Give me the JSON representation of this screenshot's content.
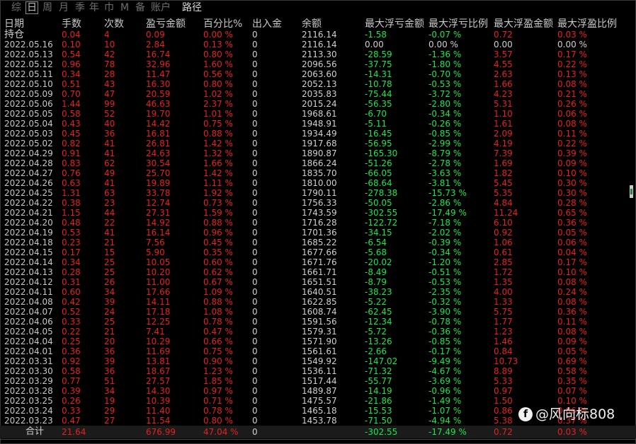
{
  "tabs": [
    {
      "label": "综",
      "active": false
    },
    {
      "label": "日",
      "active": true
    },
    {
      "label": "周",
      "active": false
    },
    {
      "label": "月",
      "active": false
    },
    {
      "label": "季",
      "active": false
    },
    {
      "label": "年",
      "active": false
    },
    {
      "label": "巾",
      "active": false
    },
    {
      "label": "M",
      "active": false
    },
    {
      "label": "备",
      "active": false
    },
    {
      "label": "账户",
      "active": false
    },
    {
      "label": "路径",
      "active": false
    }
  ],
  "headers": [
    "日期",
    "手数",
    "次数",
    "盈亏金额",
    "百分比%",
    "出入金",
    "余额",
    "最大浮亏金额",
    "最大浮亏比例",
    "最大浮盈金额",
    "最大浮盈比例"
  ],
  "holding": {
    "label": "持仓",
    "lots": "0.04",
    "count": "4",
    "pnl": "0.09",
    "pct": "0.00 %",
    "flow": "0",
    "balance": "2116.14",
    "max_loss": "-1.58",
    "max_loss_pct": "-0.07 %",
    "max_gain": "0.72",
    "max_gain_pct": "0.03 %"
  },
  "rows": [
    {
      "date": "2022.05.16",
      "lots": "0.10",
      "count": "10",
      "pnl": "2.84",
      "pct": "0.13 %",
      "flow": "0",
      "balance": "2116.14",
      "max_loss": "0.00",
      "max_loss_pct": "0.00 %",
      "max_gain": "0.00",
      "max_gain_pct": "0.00 %",
      "zero": true
    },
    {
      "date": "2022.05.13",
      "lots": "0.54",
      "count": "42",
      "pnl": "16.74",
      "pct": "0.80 %",
      "flow": "0",
      "balance": "2113.30",
      "max_loss": "-28.59",
      "max_loss_pct": "-1.36 %",
      "max_gain": "3.57",
      "max_gain_pct": "0.17 %"
    },
    {
      "date": "2022.05.12",
      "lots": "0.96",
      "count": "78",
      "pnl": "32.96",
      "pct": "1.60 %",
      "flow": "0",
      "balance": "2096.56",
      "max_loss": "-37.75",
      "max_loss_pct": "-1.80 %",
      "max_gain": "4.55",
      "max_gain_pct": "0.22 %"
    },
    {
      "date": "2022.05.11",
      "lots": "0.34",
      "count": "28",
      "pnl": "11.47",
      "pct": "0.56 %",
      "flow": "0",
      "balance": "2063.60",
      "max_loss": "-14.31",
      "max_loss_pct": "-0.70 %",
      "max_gain": "2.63",
      "max_gain_pct": "0.13 %"
    },
    {
      "date": "2022.05.10",
      "lots": "0.51",
      "count": "43",
      "pnl": "16.30",
      "pct": "0.80 %",
      "flow": "0",
      "balance": "2052.13",
      "max_loss": "-10.78",
      "max_loss_pct": "-0.53 %",
      "max_gain": "1.66",
      "max_gain_pct": "0.08 %"
    },
    {
      "date": "2022.05.09",
      "lots": "0.70",
      "count": "47",
      "pnl": "20.59",
      "pct": "1.02 %",
      "flow": "0",
      "balance": "2035.83",
      "max_loss": "-75.44",
      "max_loss_pct": "-3.72 %",
      "max_gain": "4.23",
      "max_gain_pct": "0.21 %"
    },
    {
      "date": "2022.05.06",
      "lots": "1.44",
      "count": "99",
      "pnl": "46.63",
      "pct": "2.37 %",
      "flow": "0",
      "balance": "2015.24",
      "max_loss": "-56.35",
      "max_loss_pct": "-2.80 %",
      "max_gain": "5.31",
      "max_gain_pct": "0.26 %"
    },
    {
      "date": "2022.05.05",
      "lots": "0.58",
      "count": "52",
      "pnl": "19.70",
      "pct": "1.01 %",
      "flow": "0",
      "balance": "1968.61",
      "max_loss": "-6.70",
      "max_loss_pct": "-0.34 %",
      "max_gain": "1.10",
      "max_gain_pct": "0.06 %"
    },
    {
      "date": "2022.05.04",
      "lots": "0.43",
      "count": "40",
      "pnl": "14.42",
      "pct": "0.75 %",
      "flow": "0",
      "balance": "1948.91",
      "max_loss": "-5.11",
      "max_loss_pct": "-0.26 %",
      "max_gain": "1.61",
      "max_gain_pct": "0.08 %"
    },
    {
      "date": "2022.05.03",
      "lots": "0.45",
      "count": "36",
      "pnl": "16.81",
      "pct": "0.88 %",
      "flow": "0",
      "balance": "1934.49",
      "max_loss": "-16.45",
      "max_loss_pct": "-0.85 %",
      "max_gain": "2.09",
      "max_gain_pct": "0.11 %"
    },
    {
      "date": "2022.05.02",
      "lots": "0.82",
      "count": "41",
      "pnl": "26.81",
      "pct": "1.42 %",
      "flow": "0",
      "balance": "1917.68",
      "max_loss": "-56.95",
      "max_loss_pct": "-2.99 %",
      "max_gain": "4.19",
      "max_gain_pct": "0.22 %"
    },
    {
      "date": "2022.04.29",
      "lots": "0.91",
      "count": "41",
      "pnl": "24.63",
      "pct": "1.32 %",
      "flow": "0",
      "balance": "1890.87",
      "max_loss": "-165.30",
      "max_loss_pct": "-8.79 %",
      "max_gain": "7.39",
      "max_gain_pct": "0.39 %"
    },
    {
      "date": "2022.04.28",
      "lots": "0.83",
      "count": "62",
      "pnl": "30.54",
      "pct": "1.66 %",
      "flow": "0",
      "balance": "1866.24",
      "max_loss": "-51.26",
      "max_loss_pct": "-2.78 %",
      "max_gain": "1.69",
      "max_gain_pct": "0.09 %"
    },
    {
      "date": "2022.04.27",
      "lots": "0.76",
      "count": "49",
      "pnl": "25.70",
      "pct": "1.42 %",
      "flow": "0",
      "balance": "1835.70",
      "max_loss": "-66.05",
      "max_loss_pct": "-3.63 %",
      "max_gain": "1.82",
      "max_gain_pct": "0.10 %"
    },
    {
      "date": "2022.04.26",
      "lots": "0.63",
      "count": "41",
      "pnl": "19.89",
      "pct": "1.11 %",
      "flow": "0",
      "balance": "1810.00",
      "max_loss": "-68.64",
      "max_loss_pct": "-3.81 %",
      "max_gain": "5.45",
      "max_gain_pct": "0.30 %"
    },
    {
      "date": "2022.04.25",
      "lots": "1.31",
      "count": "63",
      "pnl": "33.78",
      "pct": "1.92 %",
      "flow": "0",
      "balance": "1790.11",
      "max_loss": "-278.38",
      "max_loss_pct": "-15.73 %",
      "max_gain": "5.35",
      "max_gain_pct": "0.30 %"
    },
    {
      "date": "2022.04.22",
      "lots": "0.38",
      "count": "23",
      "pnl": "12.74",
      "pct": "0.73 %",
      "flow": "0",
      "balance": "1756.33",
      "max_loss": "-50.05",
      "max_loss_pct": "-2.86 %",
      "max_gain": "4.84",
      "max_gain_pct": "0.28 %"
    },
    {
      "date": "2022.04.21",
      "lots": "1.15",
      "count": "44",
      "pnl": "27.31",
      "pct": "1.59 %",
      "flow": "0",
      "balance": "1743.59",
      "max_loss": "-302.55",
      "max_loss_pct": "-17.49 %",
      "max_gain": "11.24",
      "max_gain_pct": "0.65 %"
    },
    {
      "date": "2022.04.20",
      "lots": "0.48",
      "count": "22",
      "pnl": "14.92",
      "pct": "0.88 %",
      "flow": "0",
      "balance": "1716.28",
      "max_loss": "-122.72",
      "max_loss_pct": "-7.18 %",
      "max_gain": "6.10",
      "max_gain_pct": "0.36 %"
    },
    {
      "date": "2022.04.19",
      "lots": "0.53",
      "count": "41",
      "pnl": "16.14",
      "pct": "0.96 %",
      "flow": "0",
      "balance": "1701.36",
      "max_loss": "-34.15",
      "max_loss_pct": "-2.02 %",
      "max_gain": "0.92",
      "max_gain_pct": "0.05 %"
    },
    {
      "date": "2022.04.18",
      "lots": "0.23",
      "count": "21",
      "pnl": "7.56",
      "pct": "0.45 %",
      "flow": "0",
      "balance": "1685.22",
      "max_loss": "-6.54",
      "max_loss_pct": "-0.39 %",
      "max_gain": "1.06",
      "max_gain_pct": "0.06 %"
    },
    {
      "date": "2022.04.15",
      "lots": "0.17",
      "count": "15",
      "pnl": "5.90",
      "pct": "0.35 %",
      "flow": "0",
      "balance": "1677.66",
      "max_loss": "-5.68",
      "max_loss_pct": "-0.34 %",
      "max_gain": "0.61",
      "max_gain_pct": "0.04 %"
    },
    {
      "date": "2022.04.14",
      "lots": "0.34",
      "count": "25",
      "pnl": "10.05",
      "pct": "0.60 %",
      "flow": "0",
      "balance": "1671.76",
      "max_loss": "-20.02",
      "max_loss_pct": "-1.20 %",
      "max_gain": "2.85",
      "max_gain_pct": "0.17 %"
    },
    {
      "date": "2022.04.13",
      "lots": "0.28",
      "count": "25",
      "pnl": "10.20",
      "pct": "0.62 %",
      "flow": "0",
      "balance": "1661.71",
      "max_loss": "-8.49",
      "max_loss_pct": "-0.51 %",
      "max_gain": "1.72",
      "max_gain_pct": "0.10 %"
    },
    {
      "date": "2022.04.12",
      "lots": "0.31",
      "count": "26",
      "pnl": "11.00",
      "pct": "0.67 %",
      "flow": "0",
      "balance": "1651.51",
      "max_loss": "-8.79",
      "max_loss_pct": "-0.53 %",
      "max_gain": "1.35",
      "max_gain_pct": "0.08 %"
    },
    {
      "date": "2022.04.11",
      "lots": "0.60",
      "count": "34",
      "pnl": "17.66",
      "pct": "1.09 %",
      "flow": "0",
      "balance": "1640.51",
      "max_loss": "-38.23",
      "max_loss_pct": "-2.35 %",
      "max_gain": "4.00",
      "max_gain_pct": "0.24 %"
    },
    {
      "date": "2022.04.08",
      "lots": "0.42",
      "count": "39",
      "pnl": "14.11",
      "pct": "0.88 %",
      "flow": "0",
      "balance": "1622.85",
      "max_loss": "-5.22",
      "max_loss_pct": "-0.32 %",
      "max_gain": "1.33",
      "max_gain_pct": "0.08 %"
    },
    {
      "date": "2022.04.07",
      "lots": "0.52",
      "count": "24",
      "pnl": "17.18",
      "pct": "1.08 %",
      "flow": "0",
      "balance": "1608.74",
      "max_loss": "-62.45",
      "max_loss_pct": "-3.90 %",
      "max_gain": "5.75",
      "max_gain_pct": "0.36 %"
    },
    {
      "date": "2022.04.06",
      "lots": "0.33",
      "count": "25",
      "pnl": "12.25",
      "pct": "0.78 %",
      "flow": "0",
      "balance": "1591.56",
      "max_loss": "-12.34",
      "max_loss_pct": "-0.78 %",
      "max_gain": "1.77",
      "max_gain_pct": "0.11 %"
    },
    {
      "date": "2022.04.05",
      "lots": "0.22",
      "count": "21",
      "pnl": "7.41",
      "pct": "0.47 %",
      "flow": "0",
      "balance": "1579.31",
      "max_loss": "-5.72",
      "max_loss_pct": "-0.36 %",
      "max_gain": "1.23",
      "max_gain_pct": "0.08 %"
    },
    {
      "date": "2022.04.04",
      "lots": "0.25",
      "count": "20",
      "pnl": "10.29",
      "pct": "0.66 %",
      "flow": "0",
      "balance": "1571.90",
      "max_loss": "-13.26",
      "max_loss_pct": "-0.85 %",
      "max_gain": "1.46",
      "max_gain_pct": "0.09 %"
    },
    {
      "date": "2022.04.01",
      "lots": "0.36",
      "count": "36",
      "pnl": "11.69",
      "pct": "0.75 %",
      "flow": "0",
      "balance": "1561.61",
      "max_loss": "-2.66",
      "max_loss_pct": "-0.17 %",
      "max_gain": "0.84",
      "max_gain_pct": "0.05 %"
    },
    {
      "date": "2022.03.31",
      "lots": "0.92",
      "count": "39",
      "pnl": "13.81",
      "pct": "0.90 %",
      "flow": "0",
      "balance": "1549.92",
      "max_loss": "-147.02",
      "max_loss_pct": "-9.49 %",
      "max_gain": "10.73",
      "max_gain_pct": "0.69 %"
    },
    {
      "date": "2022.03.30",
      "lots": "0.58",
      "count": "36",
      "pnl": "18.67",
      "pct": "1.23 %",
      "flow": "0",
      "balance": "1536.11",
      "max_loss": "-71.32",
      "max_loss_pct": "-4.67 %",
      "max_gain": "8.89",
      "max_gain_pct": "0.58 %"
    },
    {
      "date": "2022.03.29",
      "lots": "0.77",
      "count": "51",
      "pnl": "27.57",
      "pct": "1.85 %",
      "flow": "0",
      "balance": "1517.44",
      "max_loss": "-55.77",
      "max_loss_pct": "-3.69 %",
      "max_gain": "5.33",
      "max_gain_pct": "0.35 %"
    },
    {
      "date": "2022.03.28",
      "lots": "0.39",
      "count": "34",
      "pnl": "14.30",
      "pct": "0.97 %",
      "flow": "0",
      "balance": "1489.87",
      "max_loss": "-14.19",
      "max_loss_pct": "-0.96 %",
      "max_gain": "0.97",
      "max_gain_pct": "0.07 %"
    },
    {
      "date": "2022.03.25",
      "lots": "0.26",
      "count": "19",
      "pnl": "10.39",
      "pct": "0.71 %",
      "flow": "0",
      "balance": "1475.57",
      "max_loss": "-21.86",
      "max_loss_pct": "-1.49 %",
      "max_gain": "1.50",
      "max_gain_pct": "0.10 %"
    },
    {
      "date": "2022.03.24",
      "lots": "0.33",
      "count": "29",
      "pnl": "11.40",
      "pct": "0.78 %",
      "flow": "0",
      "balance": "1465.18",
      "max_loss": "-15.53",
      "max_loss_pct": "-1.07 %",
      "max_gain": "0.86",
      "max_gain_pct": "0.06 %"
    },
    {
      "date": "2022.03.23",
      "lots": "0.47",
      "count": "27",
      "pnl": "11.54",
      "pct": "0.80 %",
      "flow": "0",
      "balance": "1453.78",
      "max_loss": "-71.50",
      "max_loss_pct": "-4.94 %",
      "max_gain": "5.38",
      "max_gain_pct": "0.37 %"
    }
  ],
  "total": {
    "label": "合计",
    "lots": "21.64",
    "pnl": "676.99",
    "pct": "47.04 %",
    "flow": "0",
    "max_loss": "-302.55",
    "max_loss_pct": "-17.49 %",
    "max_gain": "0.72",
    "max_gain_pct": "0.03 %"
  },
  "watermark": {
    "icon": "facebook-icon",
    "text": "@风向标808"
  },
  "colors": {
    "background": "#000000",
    "profit": "#e8201e",
    "loss": "#16e84a",
    "neutral": "#d0d0d0",
    "header": "#c8c8c8"
  }
}
